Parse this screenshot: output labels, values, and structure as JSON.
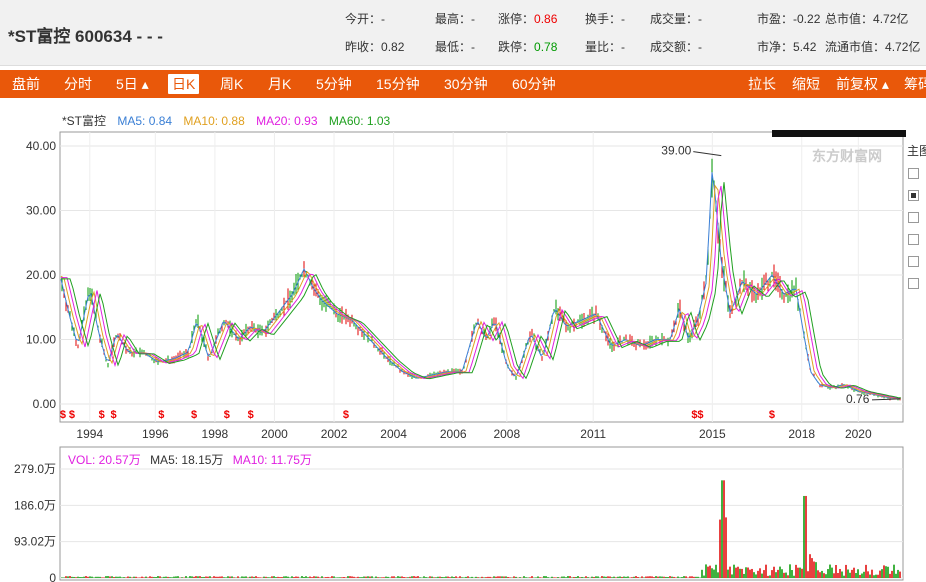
{
  "header": {
    "title": "*ST富控  600634  -  - -",
    "quotes": [
      {
        "label": "今开：",
        "value": "-",
        "cls": "v"
      },
      {
        "label": "最高：",
        "value": "-",
        "cls": "v"
      },
      {
        "label": "涨停：",
        "value": "0.86",
        "cls": "red"
      },
      {
        "label": "换手：",
        "value": "-",
        "cls": "v"
      },
      {
        "label": "成交量：",
        "value": "-",
        "cls": "v"
      },
      {
        "label": "市盈：",
        "value": "-0.22",
        "cls": "v"
      },
      {
        "label": "总市值：",
        "value": "4.72亿",
        "cls": "v"
      },
      {
        "label": "昨收：",
        "value": "0.82",
        "cls": "v"
      },
      {
        "label": "最低：",
        "value": "-",
        "cls": "v"
      },
      {
        "label": "跌停：",
        "value": "0.78",
        "cls": "green"
      },
      {
        "label": "量比：",
        "value": "-",
        "cls": "v"
      },
      {
        "label": "成交额：",
        "value": "-",
        "cls": "v"
      },
      {
        "label": "市净：",
        "value": "5.42",
        "cls": "v"
      },
      {
        "label": "流通市值：",
        "value": "4.72亿",
        "cls": "v"
      }
    ]
  },
  "toolbar": {
    "left": [
      "盘前",
      "分时",
      "5日 ▴",
      "日K",
      "周K",
      "月K",
      "5分钟",
      "15分钟",
      "30分钟",
      "60分钟"
    ],
    "active": "日K",
    "right": [
      "拉长",
      "缩短",
      "前复权 ▴",
      "筹码"
    ]
  },
  "legend": {
    "name": "*ST富控",
    "ma5": "MA5: 0.84",
    "ma10": "MA10: 0.88",
    "ma20": "MA20: 0.93",
    "ma60": "MA60: 1.03"
  },
  "volLegend": {
    "vol": "VOL: 20.57万",
    "ma5": "MA5: 18.15万",
    "ma10": "MA10: 11.75万"
  },
  "side": {
    "label": "主图"
  },
  "colors": {
    "ma5": "#3a7fd5",
    "ma10": "#e0a020",
    "ma20": "#e020e0",
    "ma60": "#20a020",
    "up": "#e00000",
    "down": "#009900",
    "accent": "#e9580a"
  },
  "chart_data": [
    {
      "type": "line",
      "title": "",
      "ylim": [
        0,
        40
      ],
      "yticks": [
        "40.00",
        "30.00",
        "20.00",
        "10.00",
        "0.00"
      ],
      "xticks": [
        "1994",
        "1996",
        "1998",
        "2000",
        "2002",
        "2004",
        "2006",
        "2008",
        "2011",
        "2015",
        "2018",
        "2020"
      ],
      "x": [
        1993.0,
        1993.3,
        1993.6,
        1994.0,
        1994.3,
        1994.6,
        1994.9,
        1995.3,
        1995.8,
        1996.3,
        1996.8,
        1997.3,
        1997.6,
        1998.0,
        1998.5,
        1999.0,
        1999.4,
        1999.8,
        2000.3,
        2000.8,
        2001.2,
        2001.5,
        2001.8,
        2002.3,
        2002.8,
        2003.2,
        2003.6,
        2004.0,
        2004.5,
        2005.0,
        2005.5,
        2006.0,
        2006.5,
        2007.0,
        2007.3,
        2007.6,
        2008.0,
        2008.3,
        2008.8,
        2009.2,
        2009.6,
        2010.0,
        2010.5,
        2011.0,
        2011.5,
        2012.0,
        2012.5,
        2013.0,
        2013.5,
        2013.8,
        2014.1,
        2014.4,
        2014.7,
        2014.9,
        2015.2,
        2015.5,
        2015.9,
        2016.4,
        2016.9,
        2017.3,
        2017.7,
        2018.0,
        2018.2,
        2018.5,
        2018.9,
        2019.3,
        2019.8,
        2020.3,
        2020.8,
        2021.2
      ],
      "series": [
        {
          "values": [
            20,
            14,
            9,
            18,
            11,
            6,
            11,
            8,
            8,
            6.5,
            7,
            8,
            13,
            7,
            13,
            10,
            12,
            11,
            14,
            17,
            21,
            18,
            16,
            14,
            13,
            11,
            9,
            7,
            5,
            4,
            4.5,
            5,
            5,
            13,
            10,
            13,
            6,
            4,
            11,
            7,
            15,
            12,
            13,
            14,
            9,
            10,
            9,
            10,
            10,
            15,
            10,
            13,
            19,
            37,
            22,
            14,
            19,
            17,
            20,
            17,
            18,
            10,
            5,
            3,
            2.5,
            3,
            2,
            1.5,
            1,
            0.8
          ]
        }
      ],
      "annotations": [
        "39.00",
        "0.76"
      ],
      "bottom_markers": 12
    },
    {
      "type": "bar",
      "title": "",
      "yticks": [
        "279.0万",
        "186.0万",
        "93.02万",
        "0"
      ],
      "ylim": [
        0,
        279
      ],
      "notes": "volume histogram, tall spikes near 2015 and 2018"
    }
  ]
}
